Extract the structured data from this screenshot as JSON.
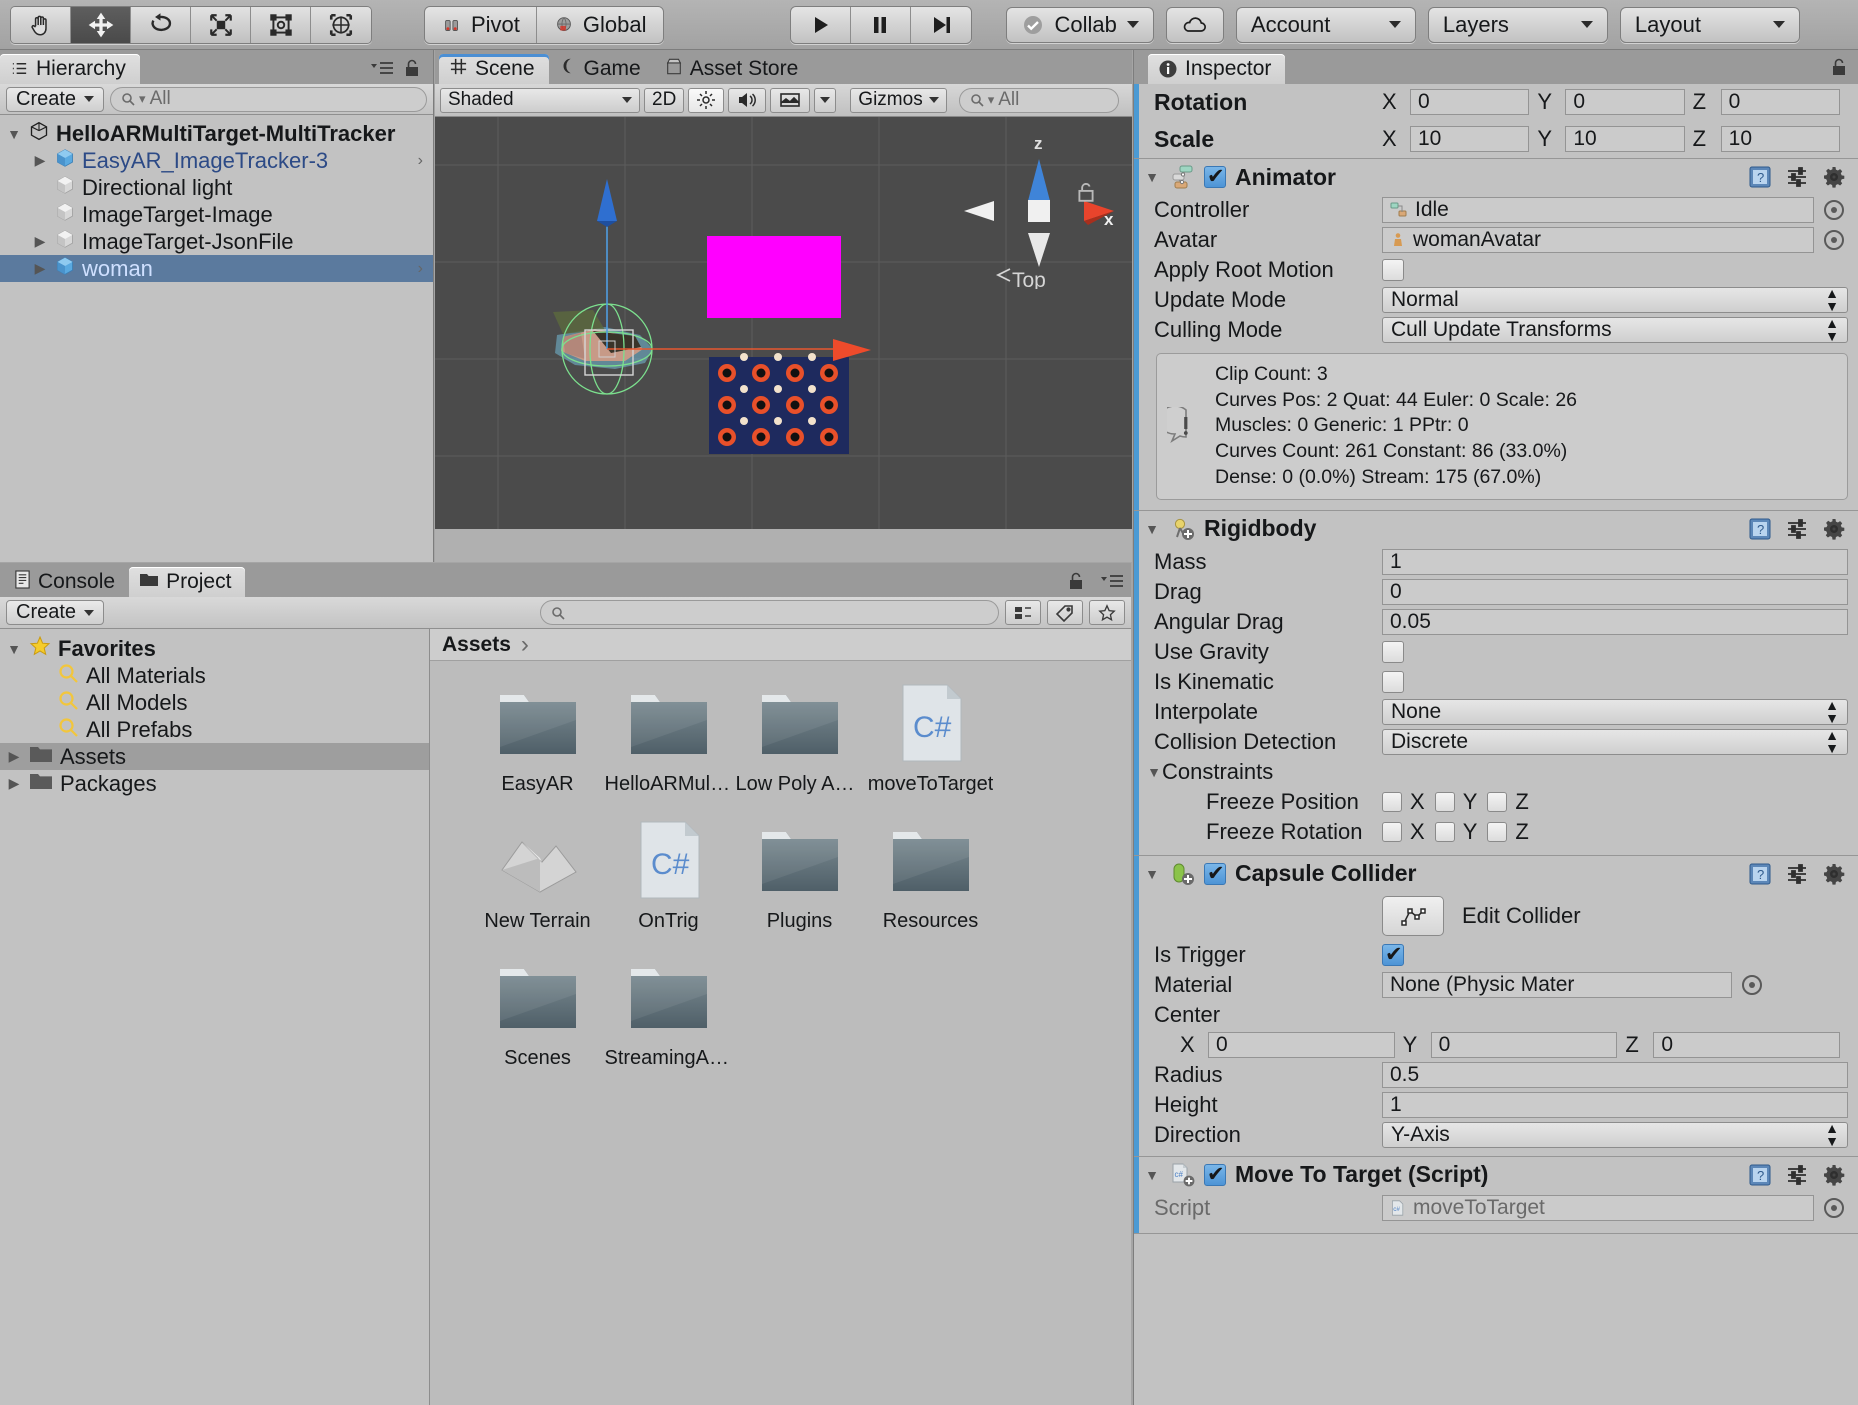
{
  "toolbar": {
    "tools": [
      {
        "name": "hand-tool",
        "active": false
      },
      {
        "name": "move-tool",
        "active": true
      },
      {
        "name": "rotate-tool",
        "active": false
      },
      {
        "name": "scale-tool",
        "active": false
      },
      {
        "name": "rect-tool",
        "active": false
      },
      {
        "name": "transform-tool",
        "active": false
      }
    ],
    "pivot_label": "Pivot",
    "global_label": "Global",
    "play_label": "play",
    "pause_label": "pause",
    "step_label": "step",
    "collab_label": "Collab",
    "cloud_label": "cloud",
    "account_label": "Account",
    "layers_label": "Layers",
    "layout_label": "Layout"
  },
  "hierarchy": {
    "tab_label": "Hierarchy",
    "create_label": "Create",
    "search_placeholder": "All",
    "items": [
      {
        "label": "HelloARMultiTarget-MultiTracker",
        "depth": 0,
        "arrow": "down",
        "icon": "unity",
        "bold": true,
        "selected": false,
        "color": "dark",
        "chevron": false
      },
      {
        "label": "EasyAR_ImageTracker-3",
        "depth": 1,
        "arrow": "right",
        "icon": "prefab",
        "bold": false,
        "selected": false,
        "color": "blue",
        "chevron": true
      },
      {
        "label": "Directional light",
        "depth": 1,
        "arrow": "none",
        "icon": "go",
        "bold": false,
        "selected": false,
        "color": "dark",
        "chevron": false
      },
      {
        "label": "ImageTarget-Image",
        "depth": 1,
        "arrow": "none",
        "icon": "go",
        "bold": false,
        "selected": false,
        "color": "dark",
        "chevron": false
      },
      {
        "label": "ImageTarget-JsonFile",
        "depth": 1,
        "arrow": "right",
        "icon": "go",
        "bold": false,
        "selected": false,
        "color": "dark",
        "chevron": false
      },
      {
        "label": "woman",
        "depth": 1,
        "arrow": "right",
        "icon": "prefab",
        "bold": false,
        "selected": true,
        "color": "blue",
        "chevron": true
      }
    ]
  },
  "scene": {
    "tabs": [
      {
        "label": "Scene",
        "icon": "grid-icon",
        "active": true
      },
      {
        "label": "Game",
        "icon": "gamepad-icon",
        "active": false
      },
      {
        "label": "Asset Store",
        "icon": "store-icon",
        "active": false
      }
    ],
    "shading_mode": "Shaded",
    "mode_2d": "2D",
    "lighting_icon": "sun-icon",
    "audio_icon": "speaker-icon",
    "effects_icon": "image-icon",
    "gizmos_label": "Gizmos",
    "search_placeholder": "All",
    "axis_labels": {
      "z": "z",
      "x": "x",
      "view": "Top"
    },
    "lock_icon": "lock-icon"
  },
  "project": {
    "tabs": [
      {
        "label": "Project",
        "icon": "folder-icon",
        "active": true
      },
      {
        "label": "Console",
        "icon": "console-icon",
        "active": false
      }
    ],
    "create_label": "Create",
    "search_placeholder": "",
    "breadcrumb": "Assets",
    "tree": [
      {
        "label": "Favorites",
        "icon": "star-icon",
        "depth": 0,
        "arrow": "down",
        "bold": true,
        "selected": false
      },
      {
        "label": "All Materials",
        "icon": "search-icon",
        "depth": 1,
        "arrow": "none",
        "bold": false,
        "selected": false
      },
      {
        "label": "All Models",
        "icon": "search-icon",
        "depth": 1,
        "arrow": "none",
        "bold": false,
        "selected": false
      },
      {
        "label": "All Prefabs",
        "icon": "search-icon",
        "depth": 1,
        "arrow": "none",
        "bold": false,
        "selected": false
      },
      {
        "label": "Assets",
        "icon": "folder-icon",
        "depth": 0,
        "arrow": "right",
        "bold": false,
        "selected": true
      },
      {
        "label": "Packages",
        "icon": "folder-icon",
        "depth": 0,
        "arrow": "right",
        "bold": false,
        "selected": false
      }
    ],
    "assets": [
      {
        "label": "EasyAR",
        "type": "folder"
      },
      {
        "label": "HelloARMulti...",
        "type": "folder"
      },
      {
        "label": "Low Poly Ani...",
        "type": "folder"
      },
      {
        "label": "moveToTarget",
        "type": "csharp"
      },
      {
        "label": "New Terrain",
        "type": "terrain"
      },
      {
        "label": "OnTrig",
        "type": "csharp"
      },
      {
        "label": "Plugins",
        "type": "folder"
      },
      {
        "label": "Resources",
        "type": "folder"
      },
      {
        "label": "Scenes",
        "type": "folder"
      },
      {
        "label": "StreamingAss...",
        "type": "folder"
      }
    ]
  },
  "inspector": {
    "tab_label": "Inspector",
    "transform": {
      "rotation_label": "Rotation",
      "rotation": {
        "x_label": "X",
        "x": "0",
        "y_label": "Y",
        "y": "0",
        "z_label": "Z",
        "z": "0"
      },
      "scale_label": "Scale",
      "scale": {
        "x_label": "X",
        "x": "10",
        "y_label": "Y",
        "y": "10",
        "z_label": "Z",
        "z": "10"
      }
    },
    "animator": {
      "title": "Animator",
      "enabled": true,
      "controller_label": "Controller",
      "controller_value": "Idle",
      "avatar_label": "Avatar",
      "avatar_value": "womanAvatar",
      "apply_root_motion_label": "Apply Root Motion",
      "apply_root_motion": false,
      "update_mode_label": "Update Mode",
      "update_mode_value": "Normal",
      "culling_mode_label": "Culling Mode",
      "culling_mode_value": "Cull Update Transforms",
      "info_lines": [
        "Clip Count: 3",
        "Curves Pos: 2 Quat: 44 Euler: 0 Scale: 26",
        "Muscles: 0 Generic: 1 PPtr: 0",
        "Curves Count: 261 Constant: 86 (33.0%)",
        "Dense: 0 (0.0%) Stream: 175 (67.0%)"
      ]
    },
    "rigidbody": {
      "title": "Rigidbody",
      "mass_label": "Mass",
      "mass": "1",
      "drag_label": "Drag",
      "drag": "0",
      "angular_drag_label": "Angular Drag",
      "angular_drag": "0.05",
      "use_gravity_label": "Use Gravity",
      "use_gravity": false,
      "is_kinematic_label": "Is Kinematic",
      "is_kinematic": false,
      "interpolate_label": "Interpolate",
      "interpolate": "None",
      "collision_detection_label": "Collision Detection",
      "collision_detection": "Discrete",
      "constraints_label": "Constraints",
      "freeze_position_label": "Freeze Position",
      "freeze_rotation_label": "Freeze Rotation",
      "axis_x": "X",
      "axis_y": "Y",
      "axis_z": "Z"
    },
    "capsule_collider": {
      "title": "Capsule Collider",
      "enabled": true,
      "edit_collider_label": "Edit Collider",
      "is_trigger_label": "Is Trigger",
      "is_trigger": true,
      "material_label": "Material",
      "material_value": "None (Physic Mater",
      "center_label": "Center",
      "center": {
        "x_label": "X",
        "x": "0",
        "y_label": "Y",
        "y": "0",
        "z_label": "Z",
        "z": "0"
      },
      "radius_label": "Radius",
      "radius": "0.5",
      "height_label": "Height",
      "height": "1",
      "direction_label": "Direction",
      "direction": "Y-Axis"
    },
    "move_to_target": {
      "title": "Move To Target (Script)",
      "enabled": true,
      "script_label": "Script",
      "script_value": "moveToTarget"
    }
  },
  "colors": {
    "accent": "#4b9ad4",
    "selection": "#5b7a9e",
    "scene_bg": "#4b4b4b",
    "magenta_quad": "#ff00ff",
    "axis_x": "#e8442c",
    "axis_z": "#3b7fd4",
    "panel_bg": "#c2c2c2"
  }
}
